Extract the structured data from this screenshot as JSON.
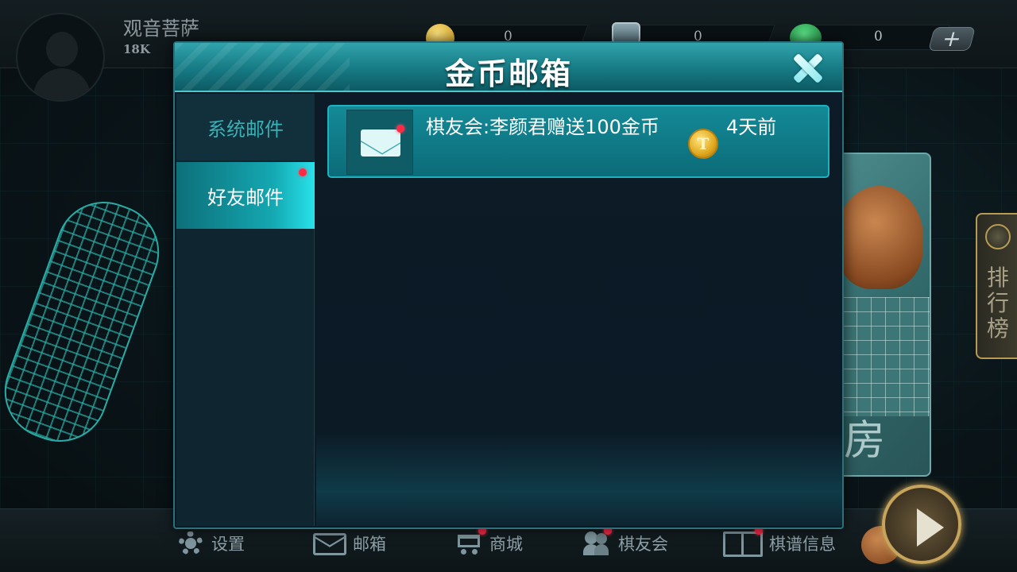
{
  "player": {
    "name": "观音菩萨",
    "rank": "18K"
  },
  "currencies": [
    {
      "icon": "gold-coin-icon",
      "value": "0"
    },
    {
      "icon": "shield-icon",
      "value": "0"
    },
    {
      "icon": "gem-icon",
      "value": "0"
    }
  ],
  "modal": {
    "title": "金币邮箱",
    "tabs": [
      {
        "label": "系统邮件",
        "active": false,
        "unread": false
      },
      {
        "label": "好友邮件",
        "active": true,
        "unread": true
      }
    ],
    "mails": [
      {
        "text": "棋友会:李颜君赠送100金币",
        "coin_icon": "gold-coin-icon",
        "coin_glyph": "T",
        "time": "4天前",
        "unread": true
      }
    ]
  },
  "side": {
    "ranking_label": "排行榜",
    "card_label": "房"
  },
  "bottom_nav": [
    {
      "label": "设置",
      "icon": "gear-icon"
    },
    {
      "label": "邮箱",
      "icon": "mail-icon"
    },
    {
      "label": "商城",
      "icon": "cart-icon"
    },
    {
      "label": "棋友会",
      "icon": "friends-icon"
    },
    {
      "label": "棋谱信息",
      "icon": "book-icon"
    }
  ],
  "colors": {
    "accent": "#14a8b2",
    "unread_dot": "#ff2a46",
    "gold": "#e0a81e"
  }
}
